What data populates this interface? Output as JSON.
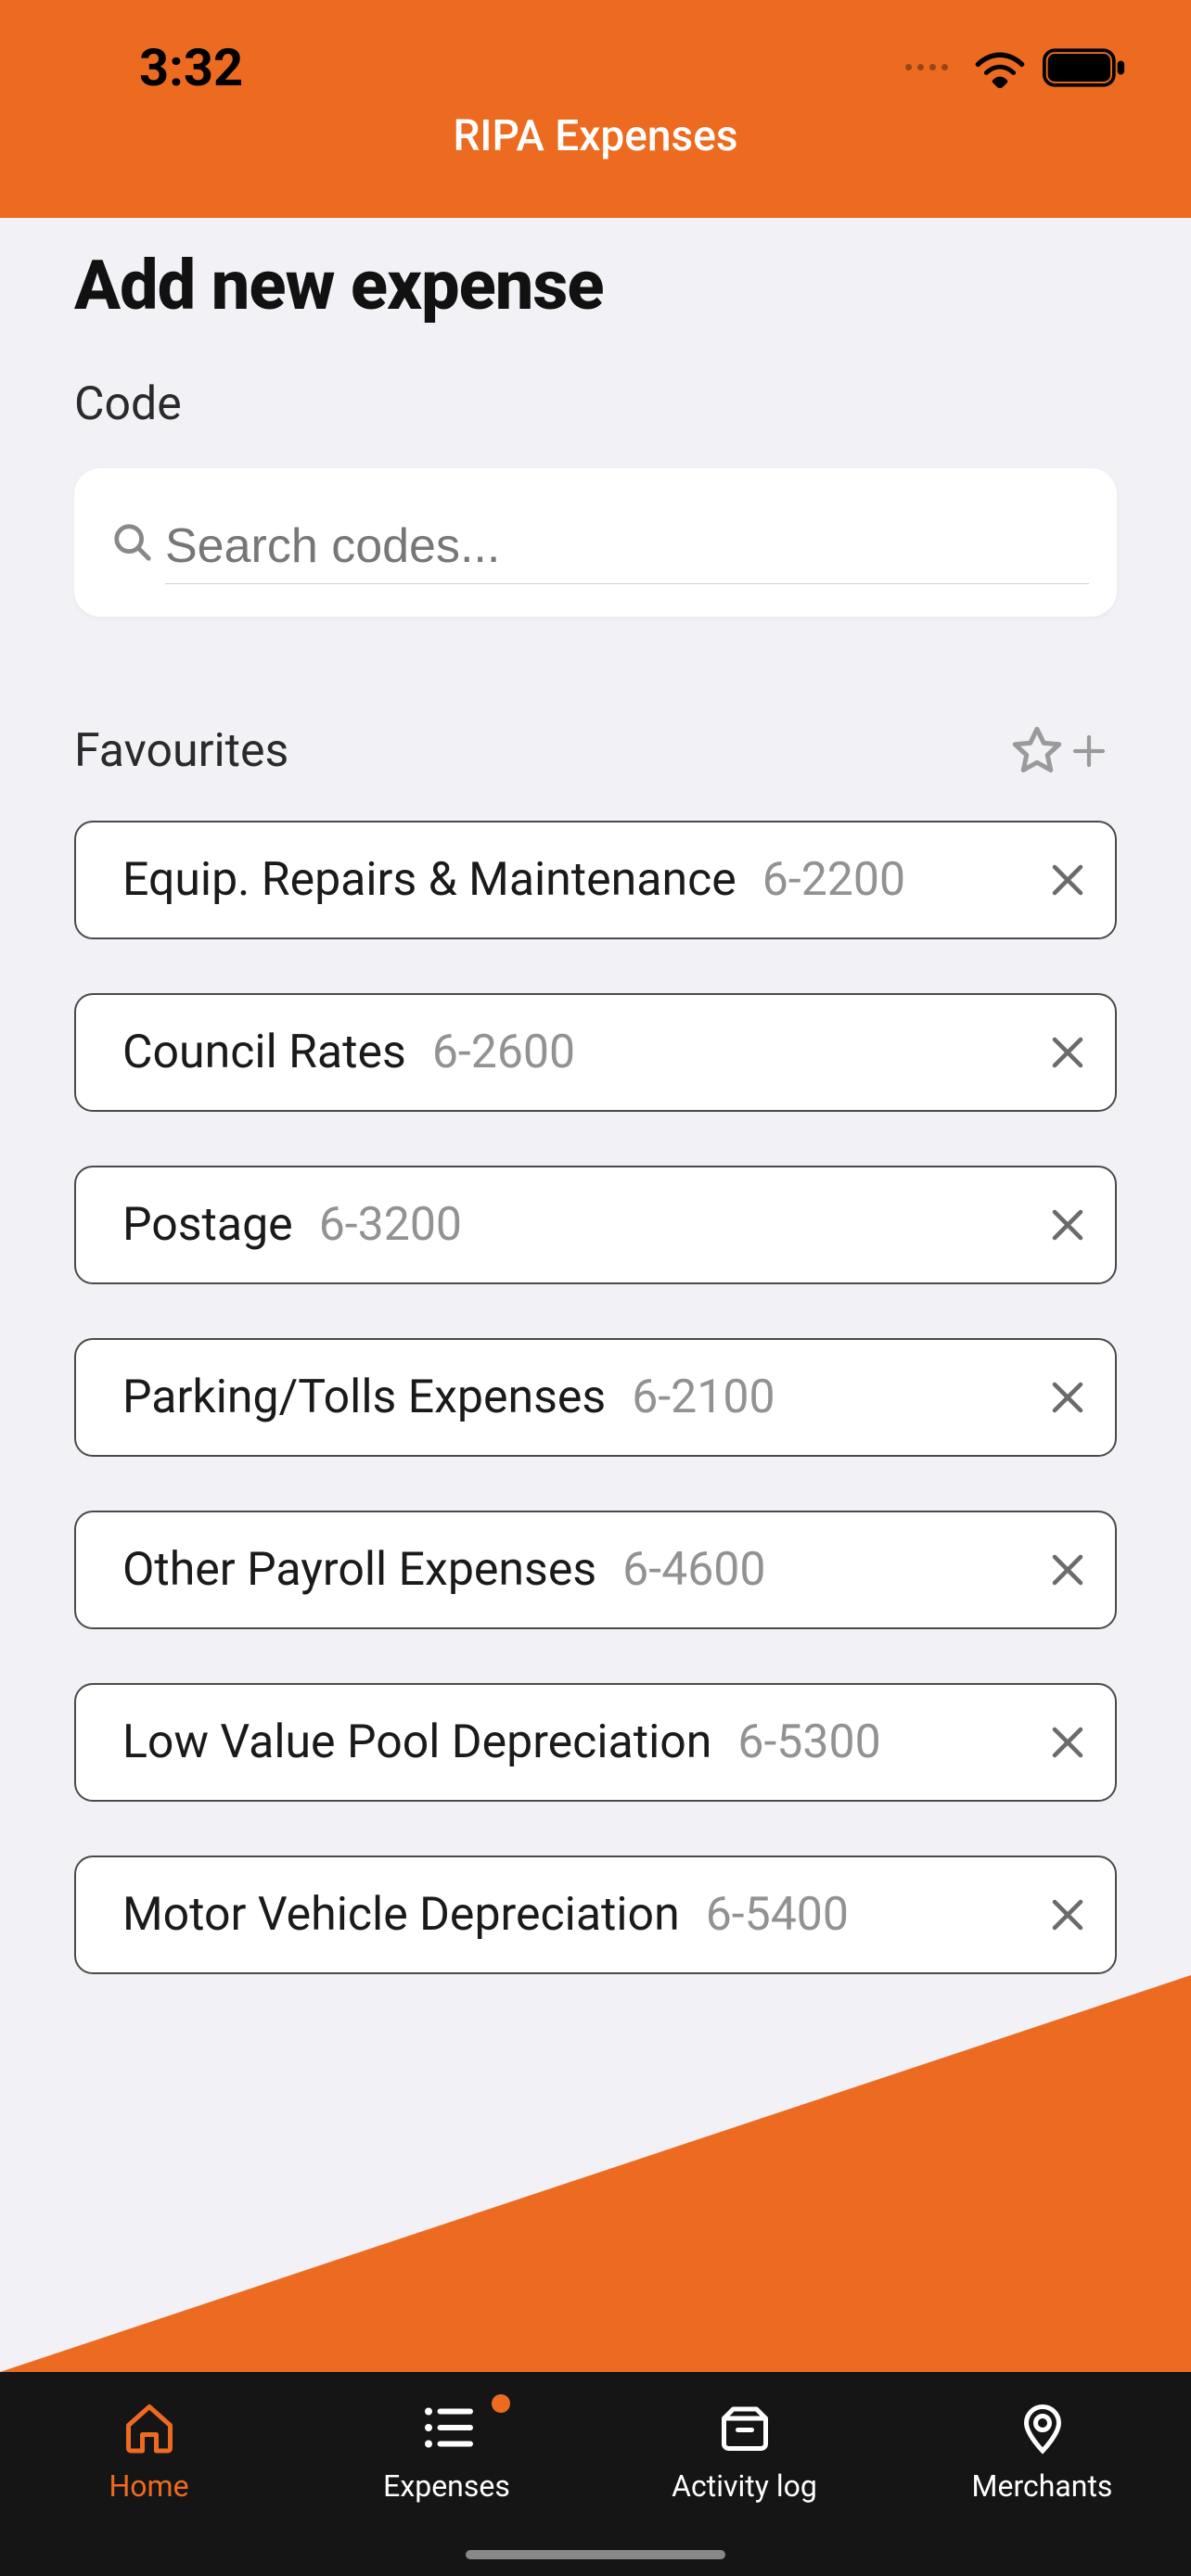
{
  "status": {
    "time": "3:32"
  },
  "header": {
    "title": "RIPA Expenses"
  },
  "page": {
    "title": "Add new expense",
    "code_label": "Code",
    "search_placeholder": "Search codes..."
  },
  "favourites": {
    "label": "Favourites",
    "items": [
      {
        "name": "Equip. Repairs & Maintenance",
        "code": "6-2200"
      },
      {
        "name": "Council Rates",
        "code": "6-2600"
      },
      {
        "name": "Postage",
        "code": "6-3200"
      },
      {
        "name": "Parking/Tolls Expenses",
        "code": "6-2100"
      },
      {
        "name": "Other Payroll Expenses",
        "code": "6-4600"
      },
      {
        "name": "Low Value Pool Depreciation",
        "code": "6-5300"
      },
      {
        "name": "Motor Vehicle Depreciation",
        "code": "6-5400"
      }
    ]
  },
  "tabs": {
    "home": "Home",
    "expenses": "Expenses",
    "activity": "Activity log",
    "merchants": "Merchants"
  },
  "colors": {
    "accent": "#ed6b21"
  }
}
